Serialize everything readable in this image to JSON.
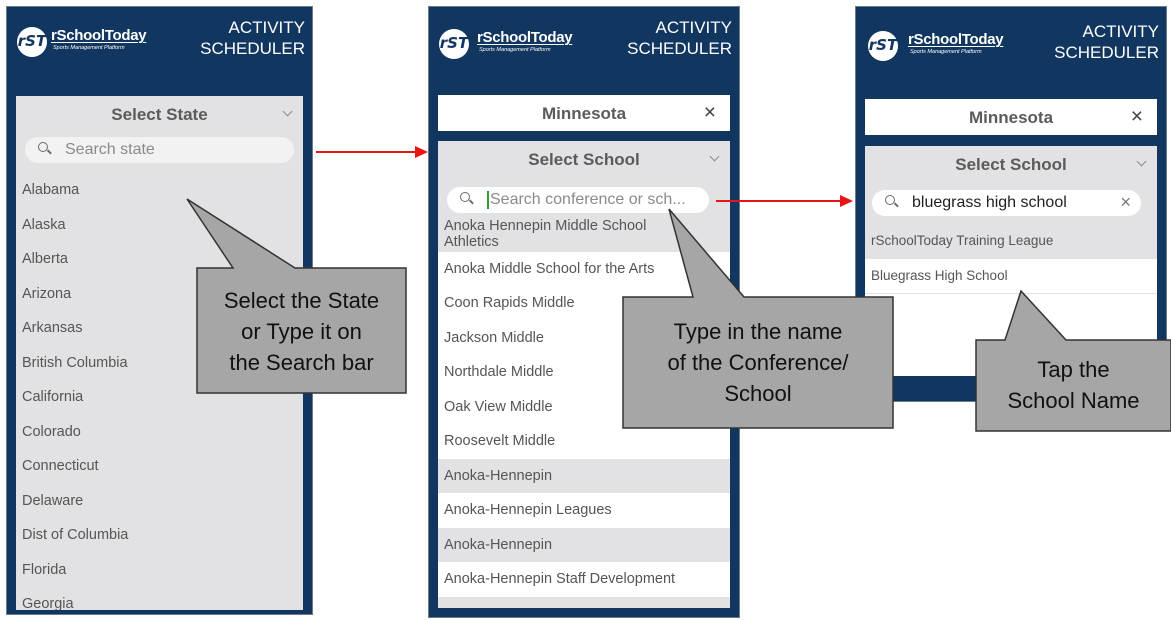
{
  "brand": {
    "name": "rSchoolToday",
    "tagline": "Sports Management Platform",
    "logo_letters": "rST"
  },
  "app_title": {
    "line1": "ACTIVITY",
    "line2": "SCHEDULER"
  },
  "screen1": {
    "select_label": "Select State",
    "search_placeholder": "Search state",
    "states": [
      "Alabama",
      "Alaska",
      "Alberta",
      "Arizona",
      "Arkansas",
      "British Columbia",
      "California",
      "Colorado",
      "Connecticut",
      "Delaware",
      "Dist of Columbia",
      "Florida",
      "Georgia"
    ]
  },
  "screen2": {
    "selected_state": "Minnesota",
    "clear_symbol": "×",
    "select_label": "Select School",
    "search_placeholder": "Search conference or sch...",
    "results": [
      {
        "line1": "Anoka Hennepin Middle School",
        "line2": "Athletics"
      },
      {
        "line1": "Anoka Middle School for the Arts"
      },
      {
        "line1": "Coon Rapids Middle"
      },
      {
        "line1": "Jackson Middle"
      },
      {
        "line1": "Northdale Middle"
      },
      {
        "line1": "Oak View Middle"
      },
      {
        "line1": "Roosevelt Middle"
      },
      {
        "line1": "Anoka-Hennepin"
      },
      {
        "line1": "Anoka-Hennepin Leagues"
      },
      {
        "line1": "Anoka-Hennepin"
      },
      {
        "line1": "Anoka-Hennepin Staff Development"
      }
    ]
  },
  "screen3": {
    "selected_state": "Minnesota",
    "clear_symbol": "×",
    "select_label": "Select School",
    "search_value": "bluegrass high school",
    "results": [
      "rSchoolToday Training League",
      "Bluegrass High School"
    ]
  },
  "callouts": {
    "c1": [
      "Select the State",
      "or Type it on",
      "the Search bar"
    ],
    "c2": [
      "Type in the name",
      "of the Conference/",
      "School"
    ],
    "c3": [
      "Tap the",
      "School Name"
    ]
  },
  "colors": {
    "header_bg": "#11365f",
    "arrow": "#e81515",
    "callout_fill": "#a6a6a6",
    "list_grey": "#e2e2e4"
  }
}
